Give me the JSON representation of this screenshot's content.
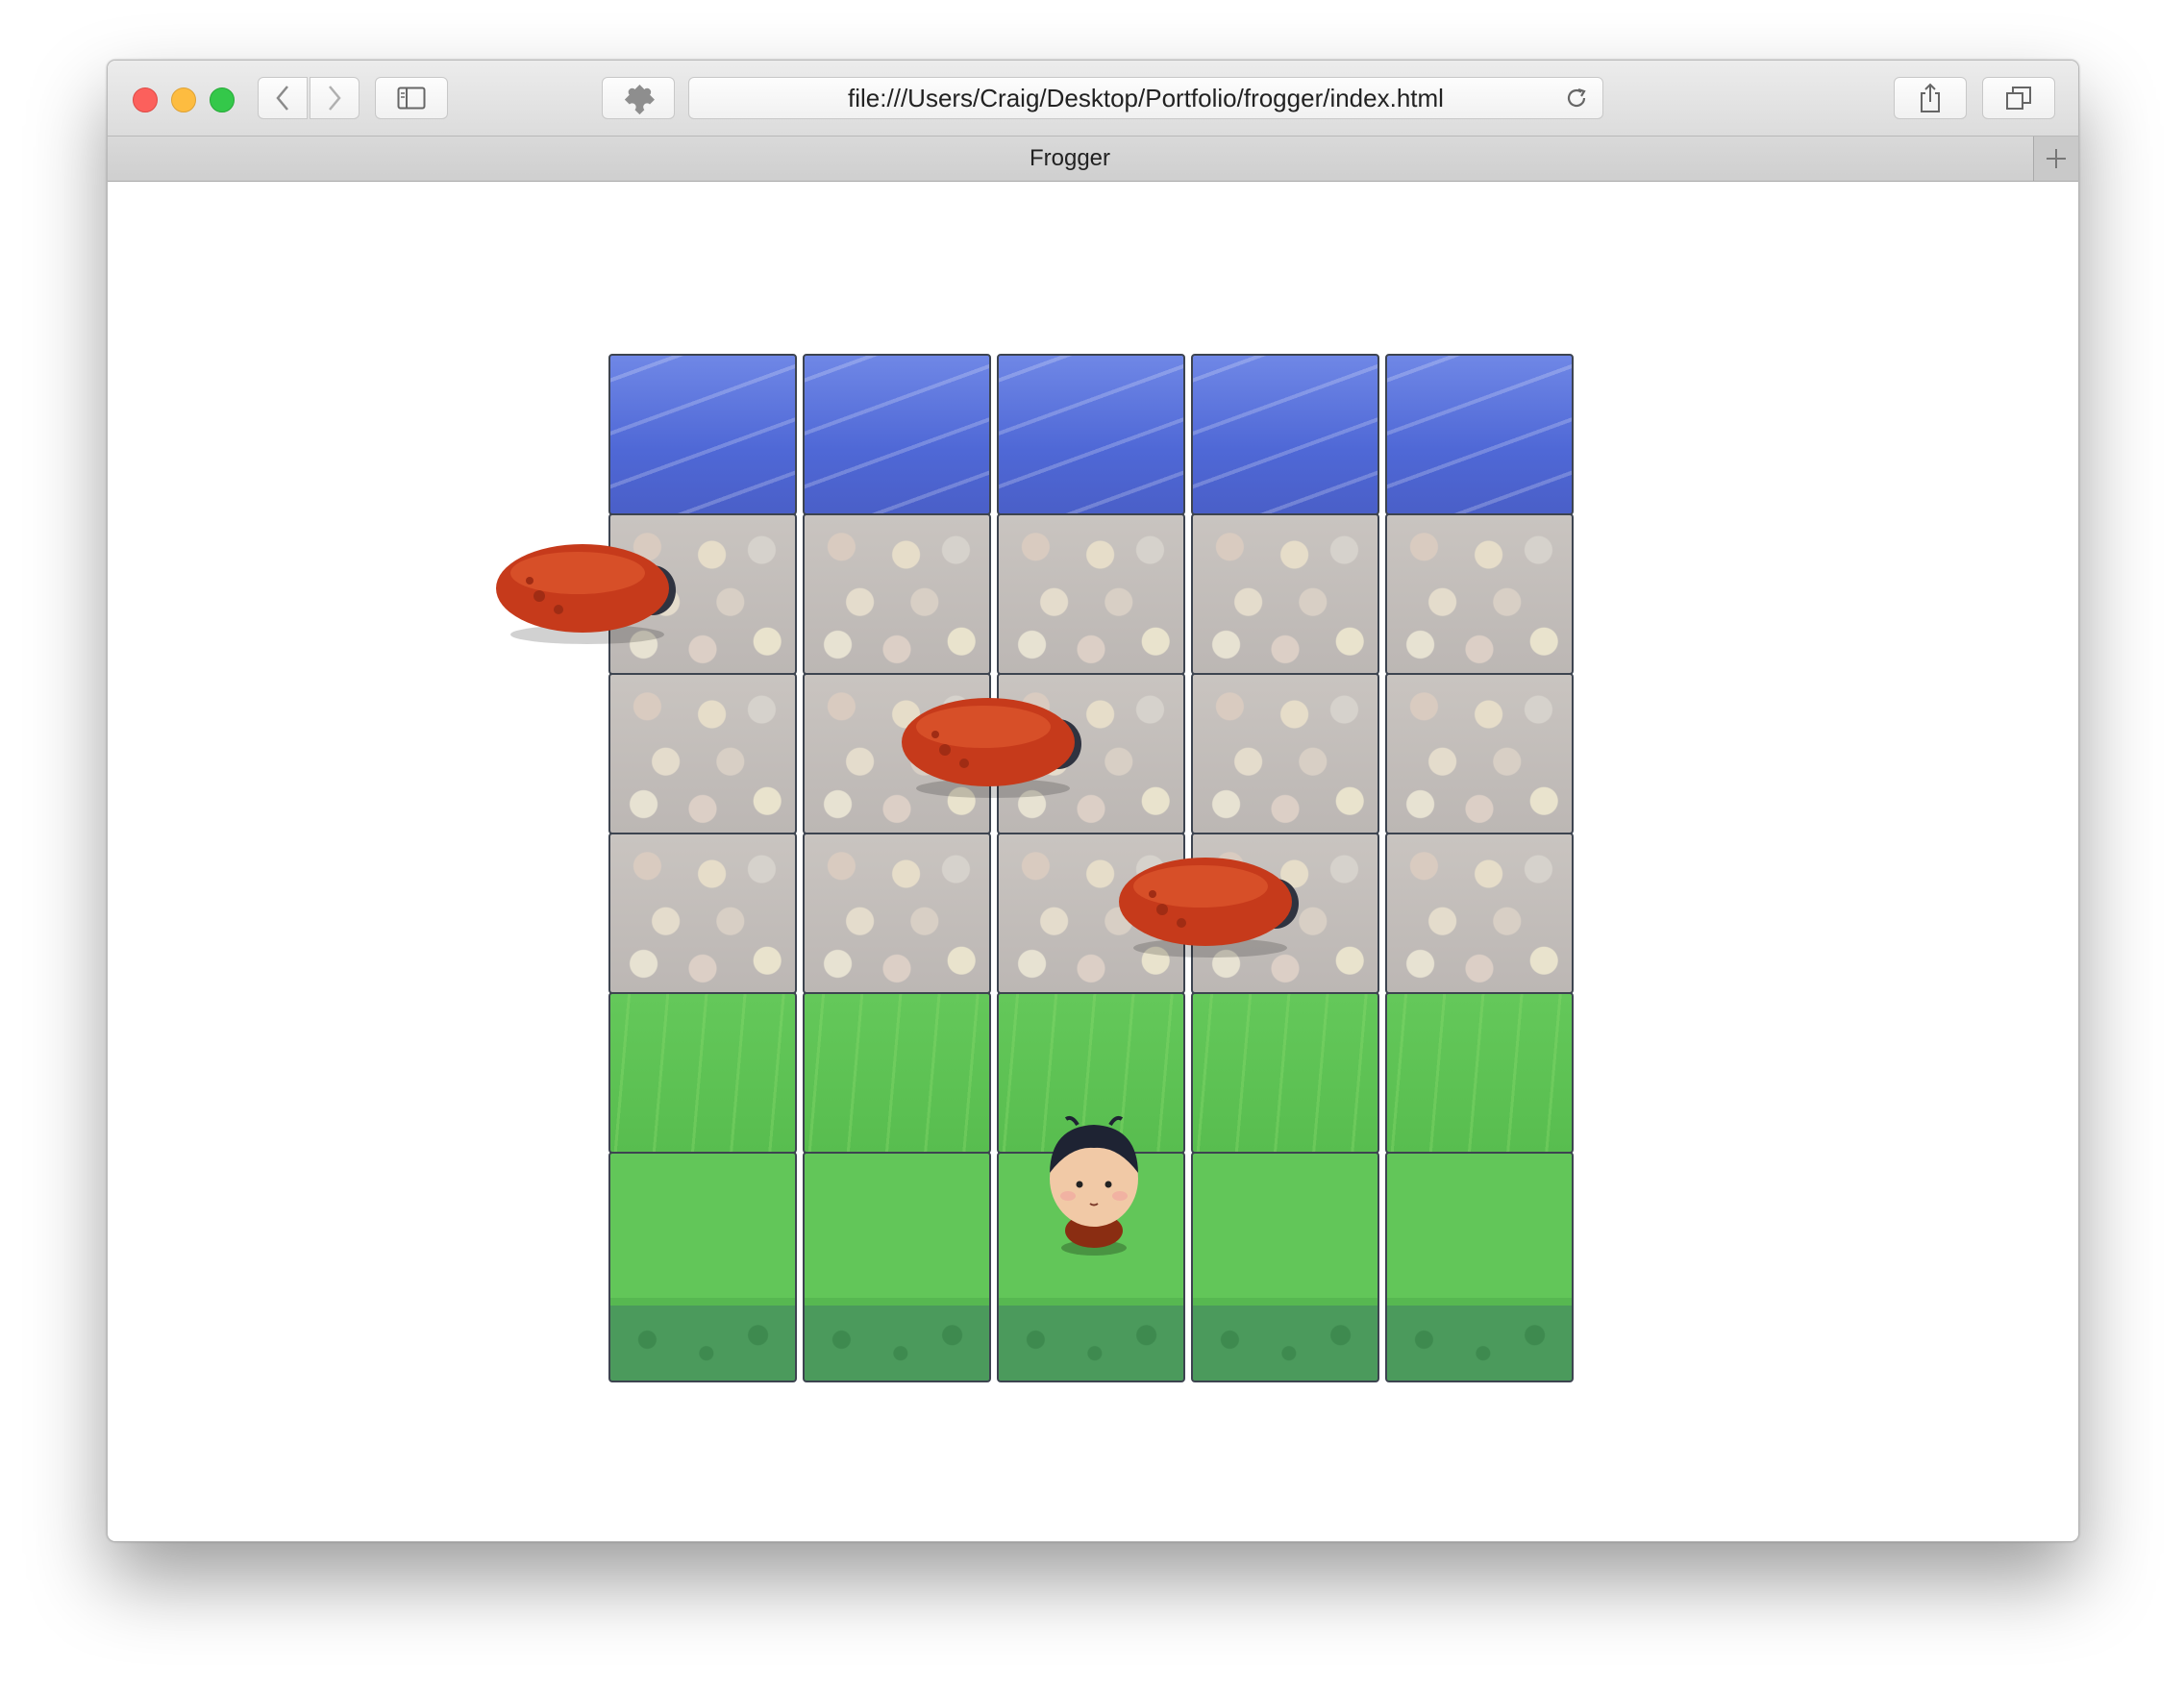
{
  "browser": {
    "address": "file:///Users/Craig/Desktop/Portfolio/frogger/index.html",
    "tab_title": "Frogger",
    "icons": {
      "back": "chevron-left-icon",
      "forward": "chevron-right-icon",
      "sidebar": "sidebar-icon",
      "extensions": "puzzle-icon",
      "reload": "reload-icon",
      "share": "share-icon",
      "tabs": "tabs-overview-icon",
      "new_tab": "plus-icon"
    }
  },
  "game": {
    "grid": {
      "columns": 5,
      "rows": [
        "water",
        "stone",
        "stone",
        "stone",
        "grass",
        "grass"
      ]
    },
    "enemies": [
      {
        "row": 1,
        "col": 0,
        "note": "partially off left edge"
      },
      {
        "row": 2,
        "col": 1
      },
      {
        "row": 3,
        "col": 2
      }
    ],
    "player": {
      "row": 5,
      "col": 2
    }
  },
  "colors": {
    "water": "#4f68d6",
    "grass": "#5ec354",
    "bug": "#c83a1e",
    "window_chrome": "#e4e4e4"
  }
}
